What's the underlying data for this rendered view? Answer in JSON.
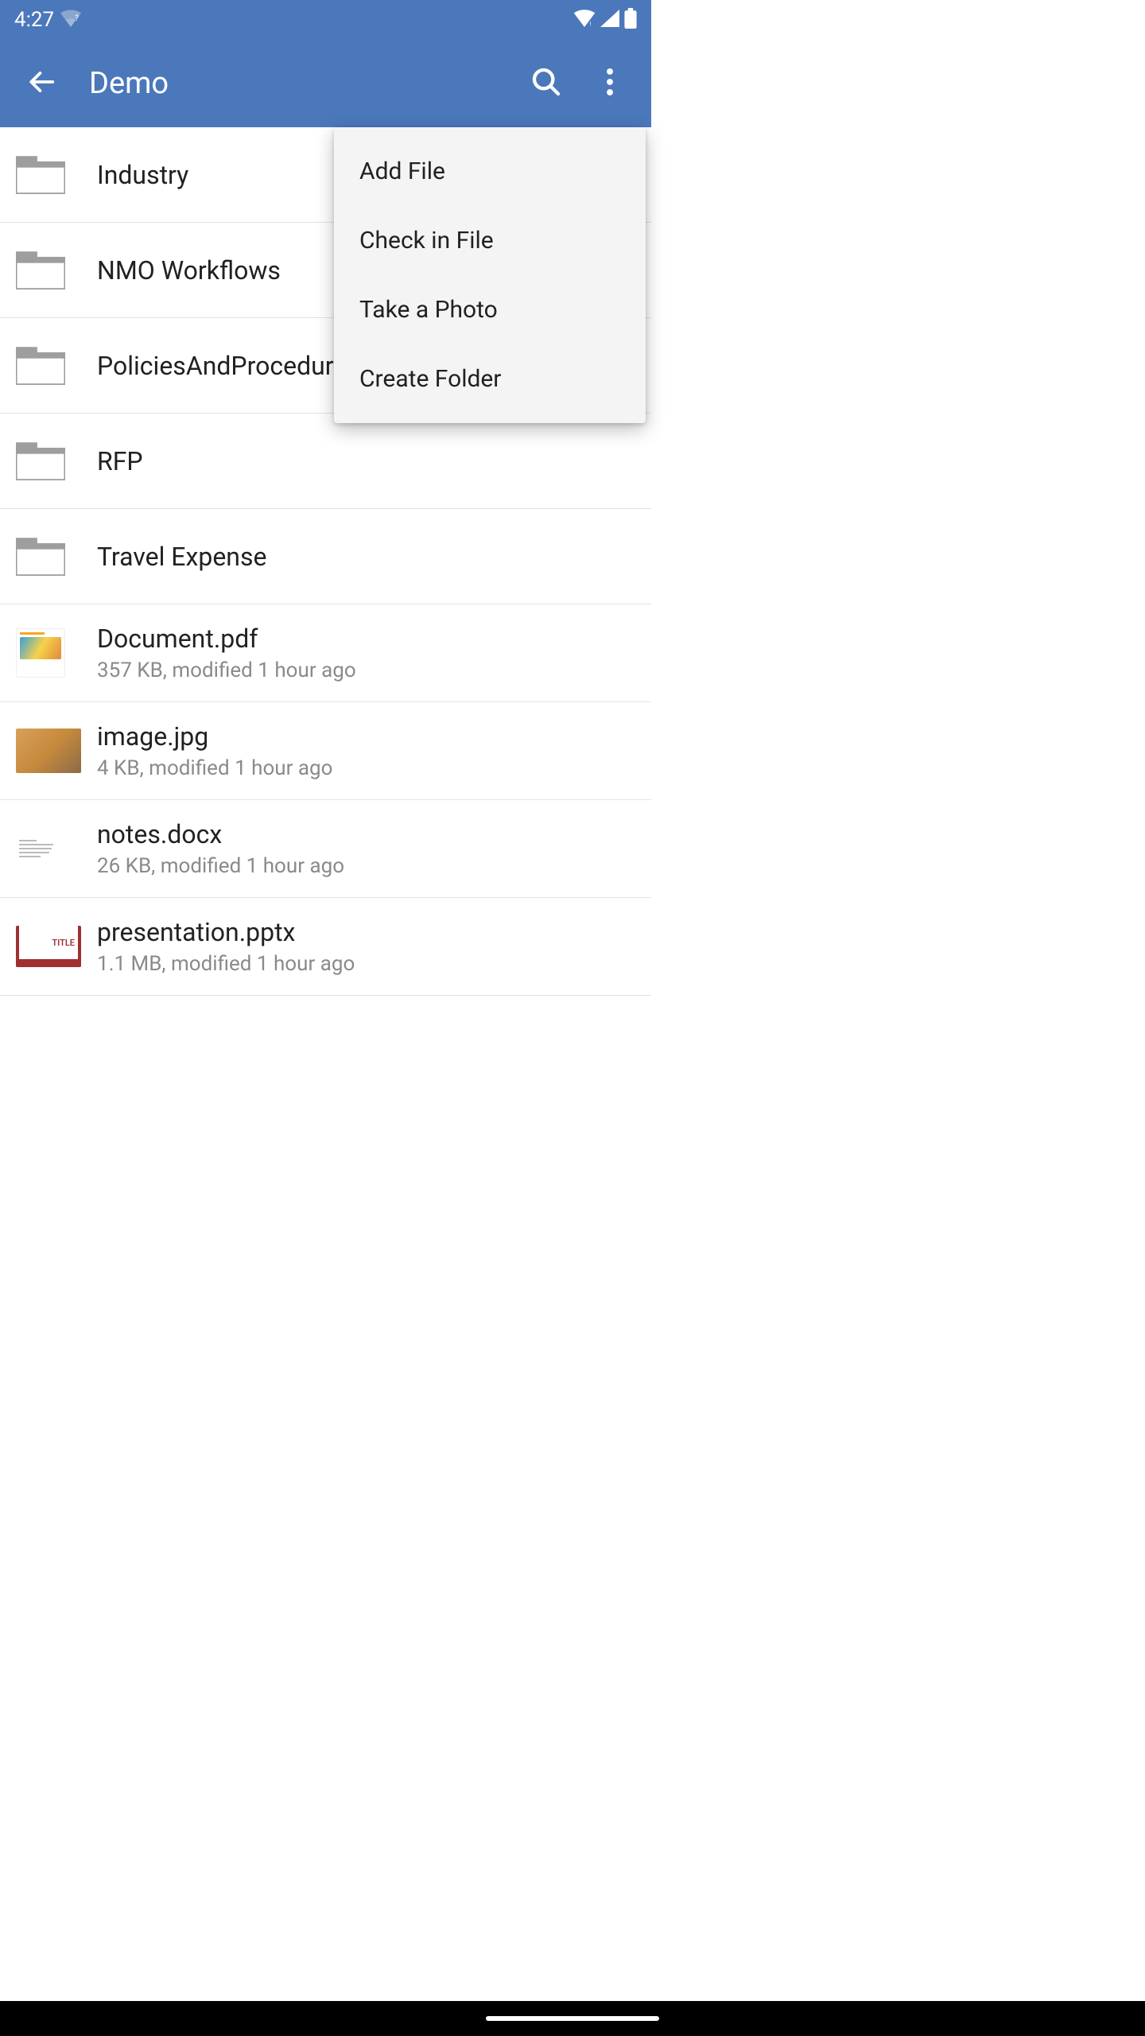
{
  "status": {
    "time": "4:27"
  },
  "header": {
    "title": "Demo"
  },
  "menu": {
    "items": [
      {
        "label": "Add File"
      },
      {
        "label": "Check in File"
      },
      {
        "label": "Take a Photo"
      },
      {
        "label": "Create Folder"
      }
    ]
  },
  "folders": [
    {
      "name": "Industry"
    },
    {
      "name": "NMO Workflows"
    },
    {
      "name": "PoliciesAndProcedures"
    },
    {
      "name": "RFP"
    },
    {
      "name": "Travel Expense"
    }
  ],
  "files": [
    {
      "name": "Document.pdf",
      "meta": "357 KB, modified 1 hour ago",
      "thumb": "pdf"
    },
    {
      "name": "image.jpg",
      "meta": "4 KB, modified 1 hour ago",
      "thumb": "photo"
    },
    {
      "name": "notes.docx",
      "meta": "26 KB, modified 1 hour ago",
      "thumb": "docx"
    },
    {
      "name": "presentation.pptx",
      "meta": "1.1 MB, modified 1 hour ago",
      "thumb": "pptx",
      "thumb_text": "TITLE"
    }
  ]
}
